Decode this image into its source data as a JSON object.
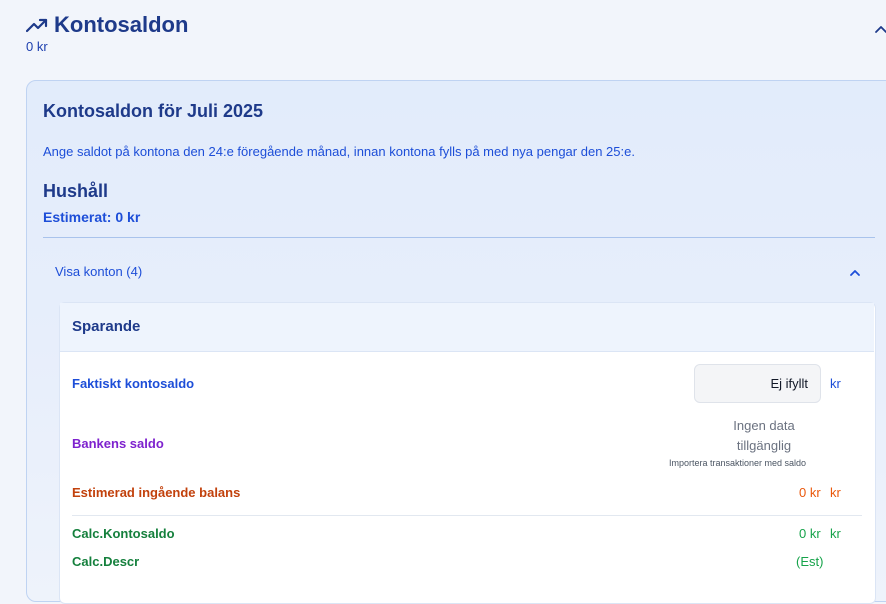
{
  "header": {
    "title": "Kontosaldon",
    "subtitle": "0 kr",
    "icon": "trending-up-icon",
    "collapse_icon": "chevron-up-icon"
  },
  "panel": {
    "title": "Kontosaldon för Juli 2025",
    "description": "Ange saldot på kontona den 24:e föregående månad, innan kontona fylls på med nya pengar den 25:e.",
    "household": {
      "name": "Hushåll",
      "estimate": "Estimerat: 0 kr"
    },
    "accounts_toggle": {
      "label": "Visa konton (4)",
      "icon": "chevron-up-icon"
    }
  },
  "account": {
    "name": "Sparande",
    "actual_balance": {
      "label": "Faktiskt kontosaldo",
      "placeholder": "Ej ifyllt",
      "unit": "kr"
    },
    "bank_balance": {
      "label": "Bankens saldo",
      "no_data": "Ingen data tillgänglig",
      "hint": "Importera transaktioner med saldo"
    },
    "estimated_opening": {
      "label": "Estimerad ingående balans",
      "value": "0 kr",
      "unit": "kr"
    },
    "calc_balance": {
      "label": "Calc.Kontosaldo",
      "value": "0 kr",
      "unit": "kr"
    },
    "calc_descr": {
      "label": "Calc.Descr",
      "value": "(Est)"
    }
  },
  "colors": {
    "primary": "#1e40af",
    "bank": "#7e22ce",
    "estimate": "#ea580c",
    "calc": "#16a34a",
    "panel_bg": "#e4edfb"
  }
}
